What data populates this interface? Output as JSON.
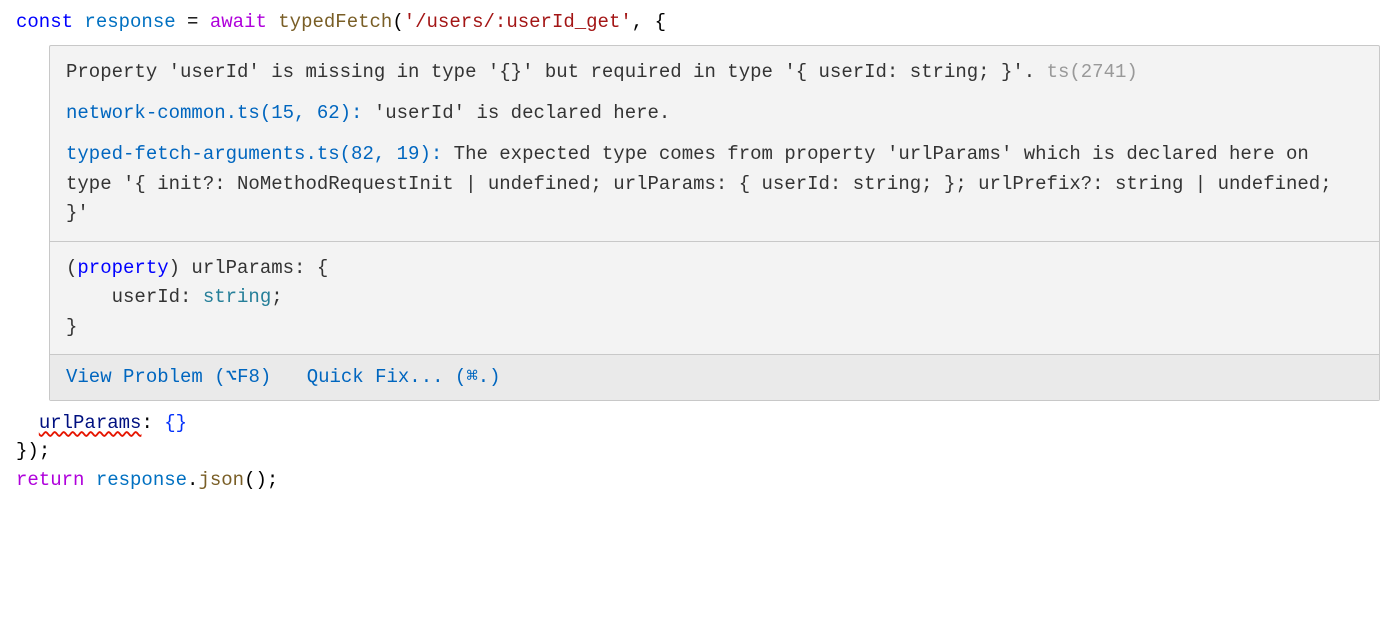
{
  "code": {
    "line1": {
      "const": "const",
      "space1": " ",
      "varname": "response",
      "space2": " ",
      "eq": "=",
      "space3": " ",
      "await": "await",
      "space4": " ",
      "fn": "typedFetch",
      "paren_open": "(",
      "str": "'/users/:userId_get'",
      "comma": ",",
      "space5": " ",
      "brace_open": "{"
    },
    "line_urlparams": {
      "indent": "  ",
      "key": "urlParams",
      "colon": ":",
      "space": " ",
      "brace_open": "{",
      "brace_close": "}"
    },
    "line_close": {
      "brace_close": "}",
      "paren_close": ")",
      "semi": ";"
    },
    "line_return": {
      "return": "return",
      "space": " ",
      "varname": "response",
      "dot": ".",
      "method": "json",
      "parens": "()",
      "semi": ";"
    }
  },
  "tooltip": {
    "error_main": "Property 'userId' is missing in type '{}' but required in type '{ userId: string; }'.",
    "ts_code": "ts(2741)",
    "ref1_link": "network-common.ts(15, 62):",
    "ref1_text": " 'userId' is declared here.",
    "ref2_link": "typed-fetch-arguments.ts(82, 19):",
    "ref2_text": " The expected type comes from property 'urlParams' which is declared here on type '{ init?: NoMethodRequestInit | undefined; urlParams: { userId: string; }; urlPrefix?: string | undefined; }'",
    "typeinfo": {
      "open": "(property) urlParams: {",
      "body": "    userId: string;",
      "close": "}"
    },
    "actions": {
      "view_problem": "View Problem (⌥F8)",
      "quick_fix": "Quick Fix... (⌘.)"
    }
  }
}
